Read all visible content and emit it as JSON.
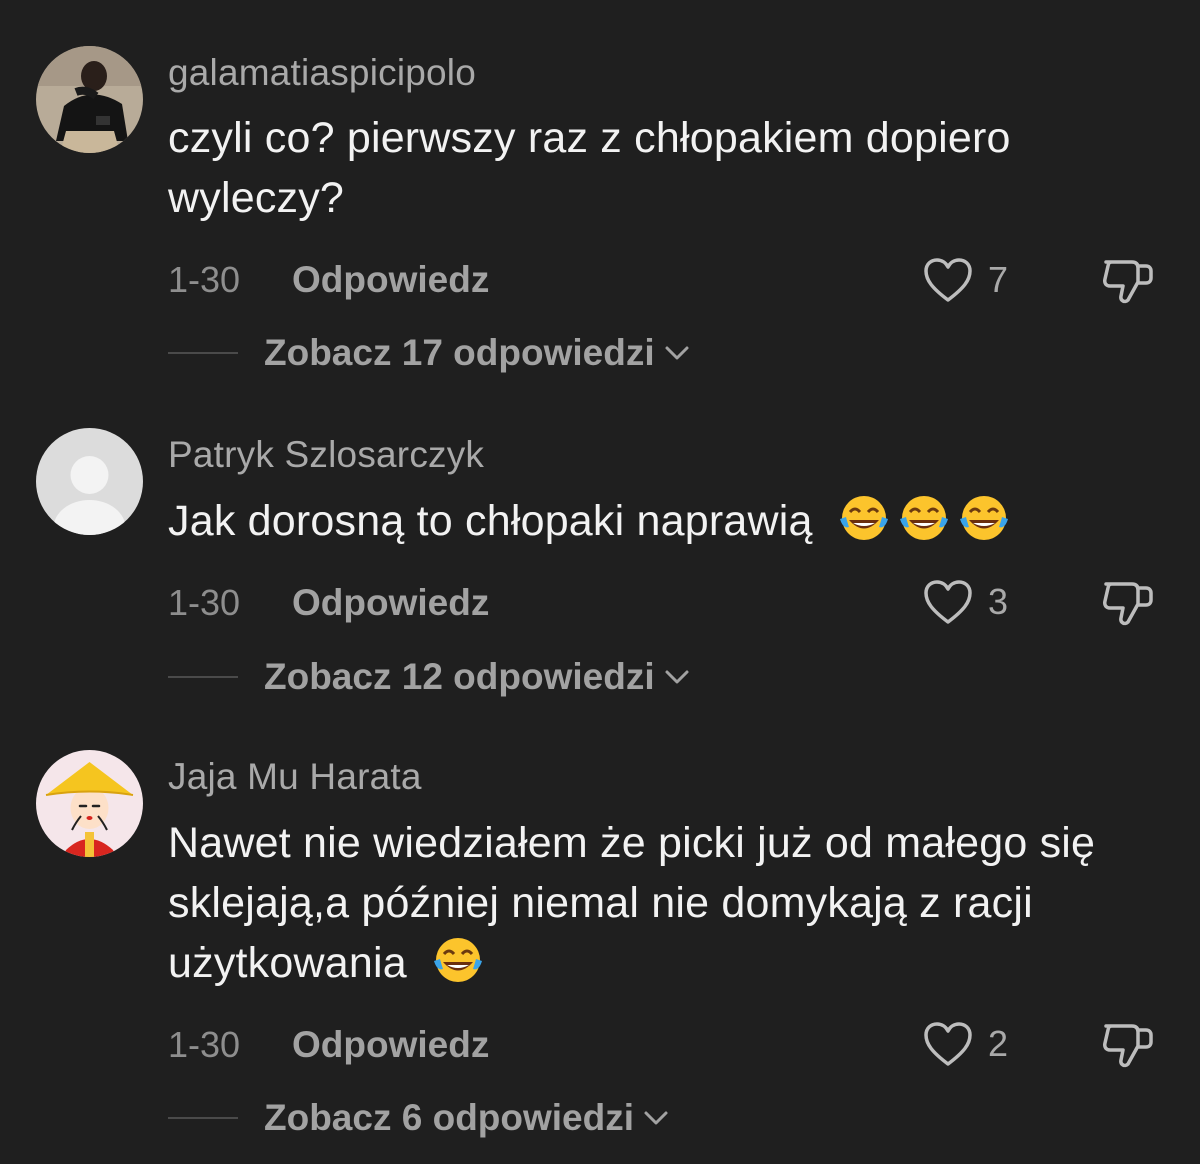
{
  "comments": [
    {
      "username": "galamatiaspicipolo",
      "text": "czyli co? pierwszy raz z chłopakiem dopiero wyleczy?",
      "date": "1-30",
      "reply_label": "Odpowiedz",
      "likes": "7",
      "view_replies": "Zobacz 17 odpowiedzi",
      "avatar": "photo-avatar"
    },
    {
      "username": "Patryk Szlosarczyk",
      "text": "Jak dorosną to chłopaki naprawią",
      "emoji_count": 3,
      "date": "1-30",
      "reply_label": "Odpowiedz",
      "likes": "3",
      "view_replies": "Zobacz 12 odpowiedzi",
      "avatar": "default-user-avatar"
    },
    {
      "username": "Jaja Mu Harata",
      "text": "Nawet nie wiedziałem że picki już od małego się sklejają,a później niemal nie domykają z racji użytkowania",
      "emoji_count": 1,
      "date": "1-30",
      "reply_label": "Odpowiedz",
      "likes": "2",
      "view_replies": "Zobacz 6 odpowiedzi",
      "avatar": "cartoon-avatar"
    }
  ],
  "icons": {
    "like": "heart-icon",
    "dislike": "thumbs-down-icon",
    "expand": "chevron-down-icon",
    "emoji": "tears-of-joy-emoji"
  },
  "colors": {
    "background": "#1f1f1f",
    "text": "#f2f2f2",
    "secondary": "#a9a9a9"
  }
}
